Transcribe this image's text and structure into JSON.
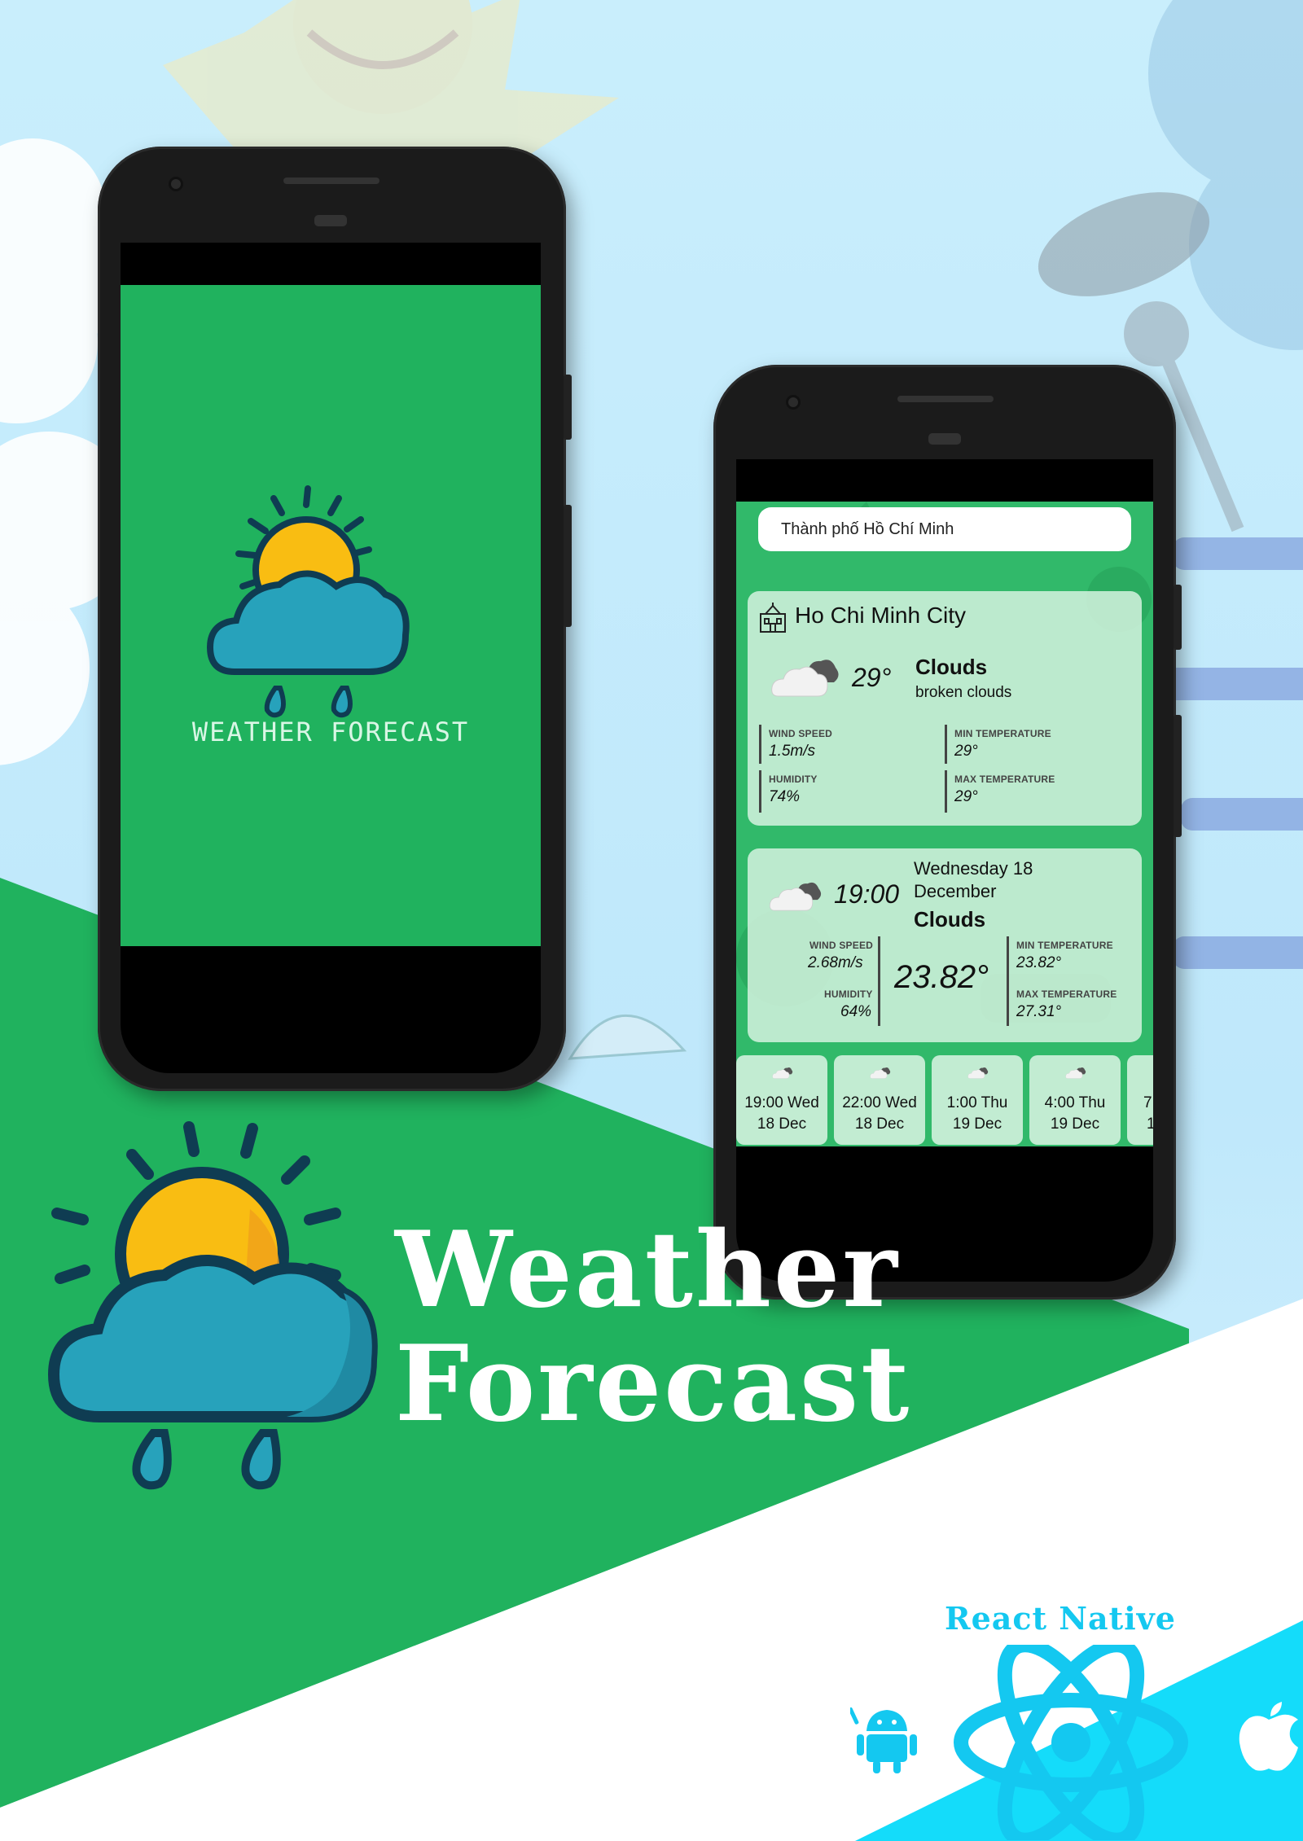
{
  "splash": {
    "title": "WEATHER FORECAST"
  },
  "app": {
    "search_value": "Thành phố Hồ Chí Minh",
    "current": {
      "city": "Ho Chi Minh City",
      "temp": "29°",
      "condition": "Clouds",
      "description": "broken clouds",
      "wind_label": "WIND SPEED",
      "wind_value": "1.5m/s",
      "humidity_label": "HUMIDITY",
      "humidity_value": "74%",
      "min_label": "MIN TEMPERATURE",
      "min_value": "29°",
      "max_label": "MAX TEMPERATURE",
      "max_value": "29°"
    },
    "forecast": {
      "time": "19:00",
      "date_line1": "Wednesday 18",
      "date_line2": "December",
      "condition": "Clouds",
      "wind_label": "WIND SPEED",
      "wind_value": "2.68m/s",
      "humidity_label": "HUMIDITY",
      "humidity_value": "64%",
      "temp": "23.82°",
      "min_label": "MIN TEMPERATURE",
      "min_value": "23.82°",
      "max_label": "MAX TEMPERATURE",
      "max_value": "27.31°"
    },
    "hourly": [
      {
        "line1": "19:00 Wed",
        "line2": "18 Dec"
      },
      {
        "line1": "22:00 Wed",
        "line2": "18 Dec"
      },
      {
        "line1": "1:00 Thu",
        "line2": "19 Dec"
      },
      {
        "line1": "4:00 Thu",
        "line2": "19 Dec"
      },
      {
        "line1": "7",
        "line2": "1"
      }
    ]
  },
  "banner": {
    "title_line1": "Weather",
    "title_line2": "Forecast",
    "framework": "React Native"
  },
  "colors": {
    "brand_green": "#20b25e",
    "react_cyan": "#14c8f0",
    "sun_yellow": "#f9bd12",
    "cloud_blue": "#27a2bb",
    "outline_navy": "#0f3c52"
  }
}
